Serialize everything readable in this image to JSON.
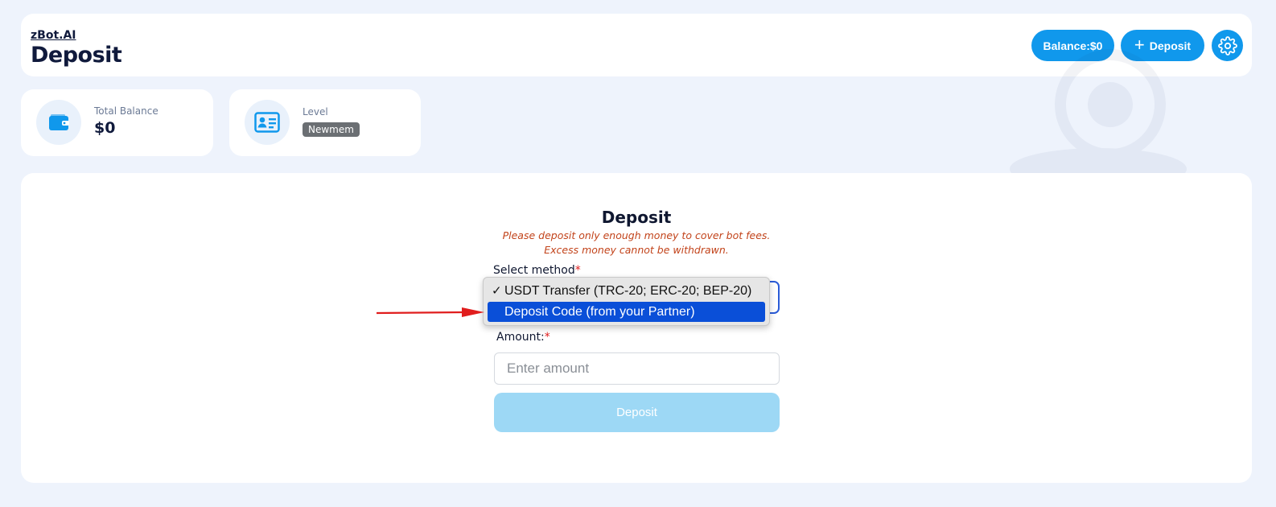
{
  "header": {
    "brand": "zBot.AI",
    "title": "Deposit",
    "balance_button": "Balance:$0",
    "deposit_button": "Deposit",
    "settings_icon": "gear-icon"
  },
  "stats": {
    "total_balance": {
      "label": "Total Balance",
      "value": "$0",
      "icon": "wallet-icon"
    },
    "level": {
      "label": "Level",
      "value": "Newmem",
      "icon": "id-card-icon"
    }
  },
  "form": {
    "title": "Deposit",
    "warning": "Please deposit only enough money to cover bot fees. Excess money cannot be withdrawn.",
    "method_label": "Select method",
    "required_mark": "*",
    "amount_label": "Amount:",
    "amount_placeholder": "Enter amount",
    "submit_label": "Deposit"
  },
  "dropdown": {
    "check_mark": "✓",
    "options": [
      {
        "label": "USDT Transfer (TRC-20; ERC-20; BEP-20)",
        "checked": true
      },
      {
        "label": "Deposit Code (from your Partner)",
        "highlighted": true
      }
    ]
  },
  "colors": {
    "accent": "#1098ec",
    "page_background": "#eef3fc",
    "warning_text": "#c2431a",
    "highlight": "#0a4fd8",
    "annotation_arrow": "#e01d1d",
    "disabled_button": "#9dd8f5"
  }
}
